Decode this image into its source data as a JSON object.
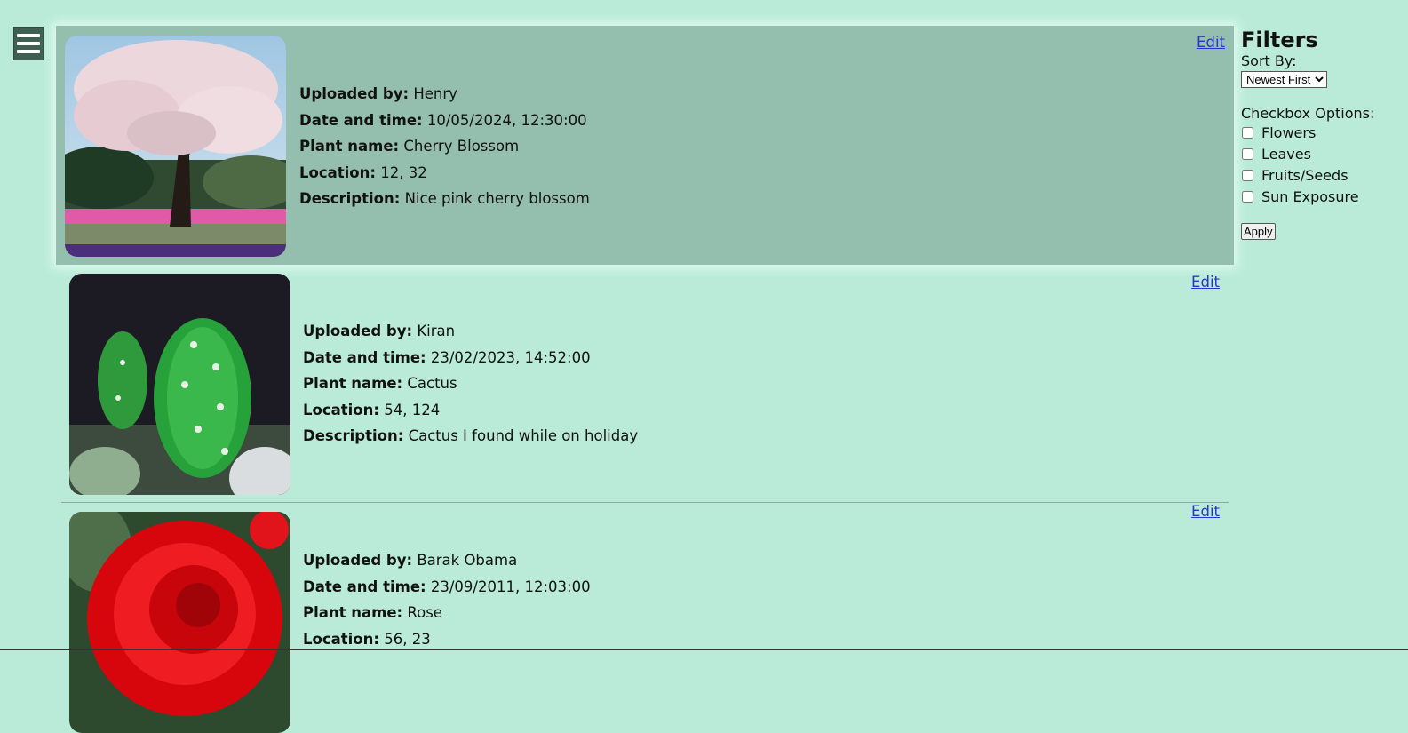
{
  "menu": {
    "icon": "hamburger-menu-icon"
  },
  "posts": [
    {
      "edit_label": "Edit",
      "image": "cherry-blossom-photo",
      "uploaded_by_label": "Uploaded by:",
      "uploaded_by": "Henry",
      "datetime_label": "Date and time:",
      "datetime": "10/05/2024, 12:30:00",
      "plant_label": "Plant name:",
      "plant": "Cherry Blossom",
      "location_label": "Location:",
      "location": "12, 32",
      "description_label": "Description:",
      "description": "Nice pink cherry blossom"
    },
    {
      "edit_label": "Edit",
      "image": "cactus-photo",
      "uploaded_by_label": "Uploaded by:",
      "uploaded_by": "Kiran",
      "datetime_label": "Date and time:",
      "datetime": "23/02/2023, 14:52:00",
      "plant_label": "Plant name:",
      "plant": "Cactus",
      "location_label": "Location:",
      "location": "54, 124",
      "description_label": "Description:",
      "description": "Cactus I found while on holiday"
    },
    {
      "edit_label": "Edit",
      "image": "rose-photo",
      "uploaded_by_label": "Uploaded by:",
      "uploaded_by": "Barak Obama",
      "datetime_label": "Date and time:",
      "datetime": "23/09/2011, 12:03:00",
      "plant_label": "Plant name:",
      "plant": "Rose",
      "location_label": "Location:",
      "location": "56, 23"
    }
  ],
  "filters": {
    "title": "Filters",
    "sort_label": "Sort By:",
    "sort_selected": "Newest First",
    "checkbox_title": "Checkbox Options:",
    "options": [
      "Flowers",
      "Leaves",
      "Fruits/Seeds",
      "Sun Exposure"
    ],
    "apply_label": "Apply"
  },
  "colors": {
    "background": "#b9ebd8",
    "highlight": "#94bead",
    "link": "#2a35c8",
    "menu": "#3f5f52"
  }
}
